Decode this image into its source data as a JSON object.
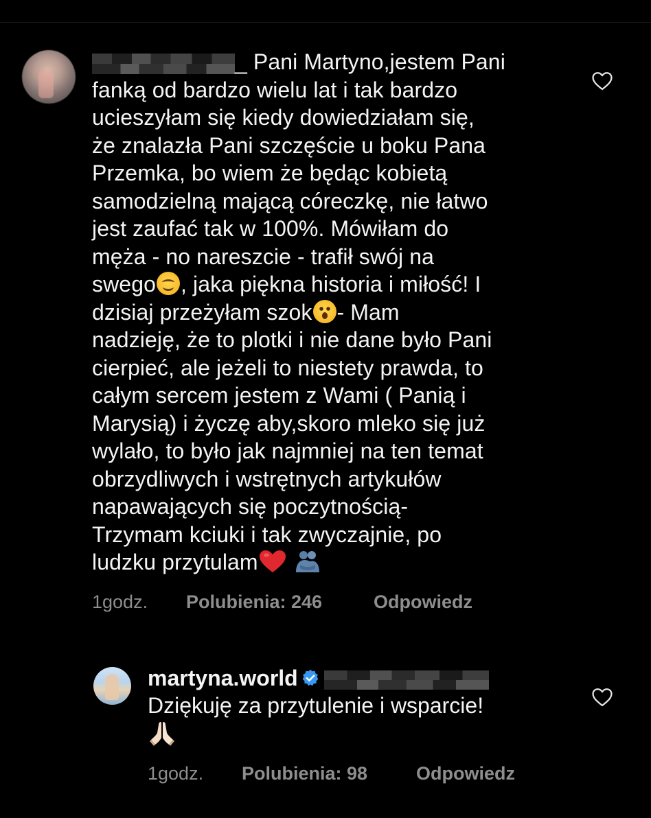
{
  "comment": {
    "username_prefix": "_",
    "lines": [
      "Pani Martyno,jestem Pani",
      "fanką od bardzo wielu lat i tak bardzo",
      "ucieszyłam się kiedy dowiedziałam się,",
      "że znalazła Pani szczęście u boku Pana",
      "Przemka, bo wiem że będąc kobietą",
      "samodzielną mającą córeczkę, nie łatwo",
      "jest zaufać tak w 100%. Mówiłam do",
      "męża - no nareszcie -  trafił swój na",
      "swego",
      ", jaka piękna historia i miłość! I",
      "dzisiaj przeżyłam szok",
      "- Mam",
      "nadzieję, że to plotki i nie dane było Pani",
      "cierpieć,  ale jeżeli to niestety prawda, to",
      "całym sercem jestem z Wami ( Panią i",
      "Marysią) i życzę aby,skoro mleko się już",
      "wylało, to było jak najmniej na ten temat",
      "obrzydliwych i wstrętnych artykułów",
      "napawających się poczytnością-",
      "Trzymam kciuki i tak zwyczajnie, po",
      "ludzku przytulam"
    ],
    "time": "1godz.",
    "likes": "Polubienia: 246",
    "reply_label": "Odpowiedz"
  },
  "reply": {
    "username": "martyna.world",
    "text": "Dziękuję za przytulenie i wsparcie!",
    "time": "1godz.",
    "likes": "Polubienia: 98",
    "reply_label": "Odpowiedz"
  },
  "icons": {
    "like": "heart-outline-icon",
    "verified": "verified-badge-icon",
    "emoji_smile": "smiling-face-emoji",
    "emoji_surprised": "hushed-face-emoji",
    "emoji_heart": "red-heart-emoji",
    "emoji_hug": "people-hugging-emoji",
    "emoji_pray": "folded-hands-emoji"
  },
  "colors": {
    "background": "#000000",
    "text": "#f4f4f4",
    "meta": "#8e8e8e",
    "verified": "#3897f0",
    "heart_emoji": "#e0282e"
  }
}
